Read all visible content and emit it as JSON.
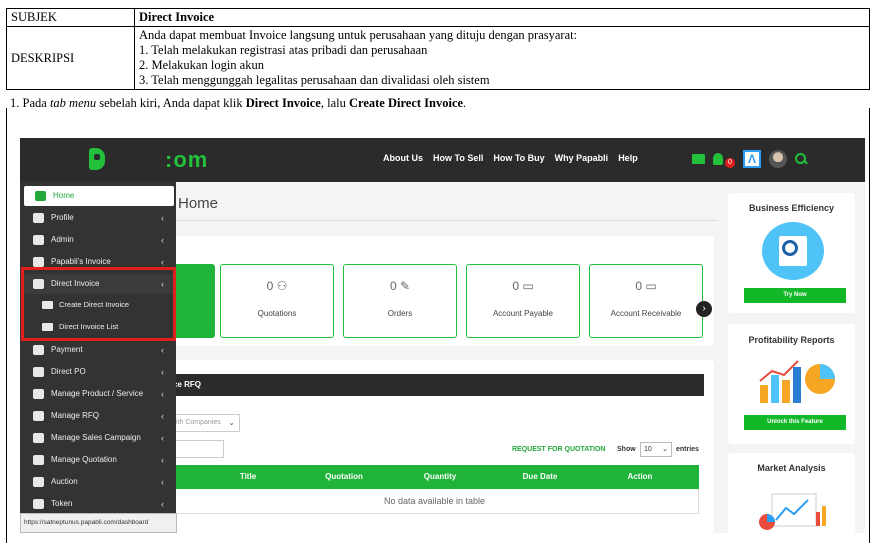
{
  "document": {
    "subject_label": "SUBJEK",
    "subject_value": "Direct Invoice",
    "description_label": "DESKRIPSI",
    "description_lines": [
      "Anda dapat membuat Invoice langsung untuk perusahaan yang dituju dengan prasyarat:",
      "1. Telah melakukan registrasi atas pribadi dan perusahaan",
      "2. Melakukan login akun",
      "3. Telah menggunggah legalitas perusahaan dan divalidasi oleh sistem"
    ],
    "step": {
      "prefix": "1. Pada ",
      "tab_menu": "tab menu",
      "mid": " sebelah kiri, Anda dapat klik ",
      "direct_invoice": "Direct Invoice",
      "mid2": ", lalu ",
      "create_direct_invoice": "Create Direct Invoice",
      "end": "."
    }
  },
  "app": {
    "logo_text": ":om",
    "nav": [
      "About Us",
      "How To Sell",
      "How To Buy",
      "Why Papabli",
      "Help"
    ],
    "notification_count": "0",
    "page_title": "Home",
    "stats": [
      {
        "count": "0",
        "label": "Quotations"
      },
      {
        "count": "0",
        "label": "Orders"
      },
      {
        "count": "0",
        "label": "Account Payable"
      },
      {
        "count": "0",
        "label": "Account Receivable"
      }
    ],
    "rfq": {
      "header": "ce RFQ",
      "company_select": "ith Companies",
      "request_link": "REQUEST FOR QUOTATION",
      "show_label": "Show",
      "entries_value": "10",
      "entries_label": "entries",
      "columns": [
        "",
        "Title",
        "Quotation",
        "Quantity",
        "Due Date",
        "Action"
      ],
      "empty_message": "No data available in table"
    },
    "side_cards": [
      {
        "title": "Business Efficiency",
        "button": "Try Now"
      },
      {
        "title": "Profitability Reports",
        "button": "Unlock this Feature"
      },
      {
        "title": "Market Analysis"
      }
    ],
    "sidebar": {
      "items": [
        "Home",
        "Profile",
        "Admin",
        "Papabli's Invoice",
        "Direct Invoice"
      ],
      "sub_items": [
        "Create Direct Invoice",
        "Direct Invoice List"
      ],
      "items_after": [
        "Payment",
        "Direct PO",
        "Manage Product / Service",
        "Manage RFQ",
        "Manage Sales Campaign",
        "Manage Quotation",
        "Auction",
        "Token"
      ]
    },
    "status_url": "https://satneptunus.papabli.com/dashboard"
  }
}
